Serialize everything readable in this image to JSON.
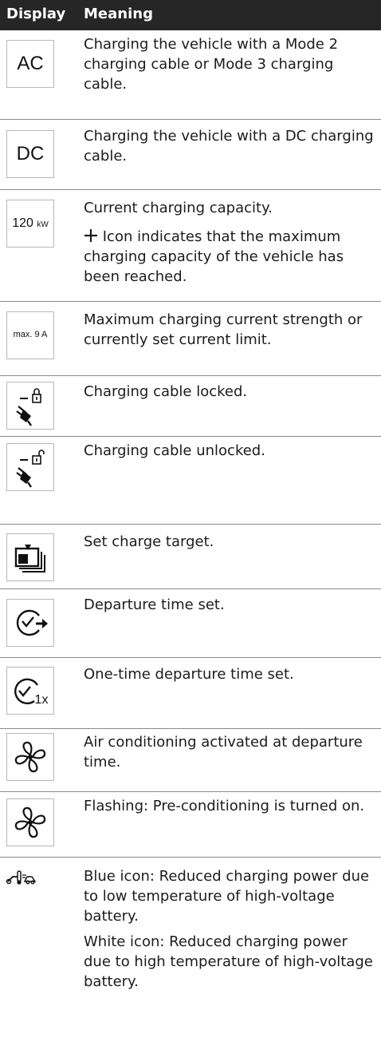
{
  "header": {
    "display": "Display",
    "meaning": "Meaning"
  },
  "rows": [
    {
      "icon_text": "AC",
      "meaning": "Charging the vehicle with a Mode 2 charging cable or Mode 3 charging cable."
    },
    {
      "icon_text": "DC",
      "meaning": "Charging the vehicle with a DC charging cable."
    },
    {
      "icon_value": "120",
      "icon_unit": "kW",
      "meaning": "Current charging capacity.",
      "note_icon": "plus-icon",
      "note": "Icon indicates that the maximum charging capacity of the vehicle has been reached."
    },
    {
      "icon_text": "max. 9 A",
      "meaning": "Maximum charging current strength or currently set current limit."
    },
    {
      "icon": "cable-locked-icon",
      "meaning": "Charging cable locked."
    },
    {
      "icon": "cable-unlocked-icon",
      "meaning": "Charging cable unlocked."
    },
    {
      "icon": "charge-target-icon",
      "meaning": "Set charge target."
    },
    {
      "icon": "departure-time-icon",
      "meaning": "Departure time set."
    },
    {
      "icon": "one-time-departure-icon",
      "icon_text": "1x",
      "meaning": "One-time departure time set."
    },
    {
      "icon": "fan-icon",
      "meaning": "Air conditioning activated at departure time."
    },
    {
      "icon": "fan-icon",
      "meaning": "Flashing: Pre-conditioning is turned on."
    },
    {
      "icon": "battery-temperature-icon",
      "meaning": "Blue icon: Reduced charging power due to low temperature of high-voltage battery.",
      "meaning2": "White icon: Reduced charging power due to high temperature of high-voltage battery."
    }
  ]
}
